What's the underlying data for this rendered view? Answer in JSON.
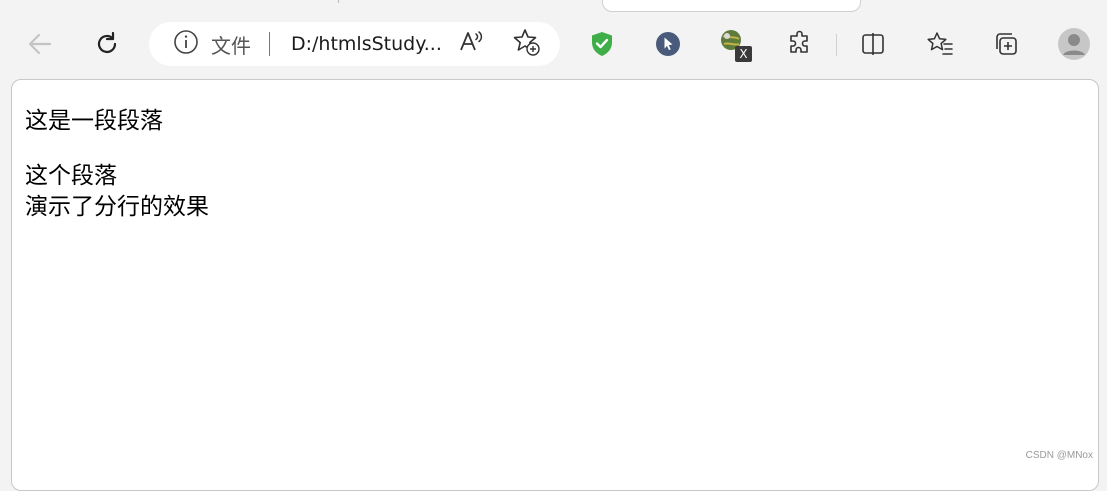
{
  "toolbar": {
    "address_bar": {
      "info_label": "文件",
      "url": "D:/htmlsStudy..."
    }
  },
  "icons": {
    "back": "arrow-left-icon",
    "refresh": "refresh-icon",
    "info": "info-icon",
    "read_aloud": "read-aloud-icon",
    "add_favorite": "star-plus-icon",
    "shield_extension": "shield-check-icon",
    "cursor_extension": "cursor-icon",
    "excel_extension": "excel-globe-icon",
    "extensions": "puzzle-icon",
    "split_screen": "split-screen-icon",
    "favorites": "favorites-list-icon",
    "collections": "collections-icon",
    "profile": "avatar-icon"
  },
  "colors": {
    "toolbar_bg": "#f3f3f3",
    "shield_green": "#3fae49",
    "cursor_badge": "#4a5a7a"
  },
  "page": {
    "paragraph1": "这是一段段落",
    "paragraph2_line1": "这个段落",
    "paragraph2_line2": "演示了分行的效果"
  },
  "watermark": "CSDN @MNox"
}
